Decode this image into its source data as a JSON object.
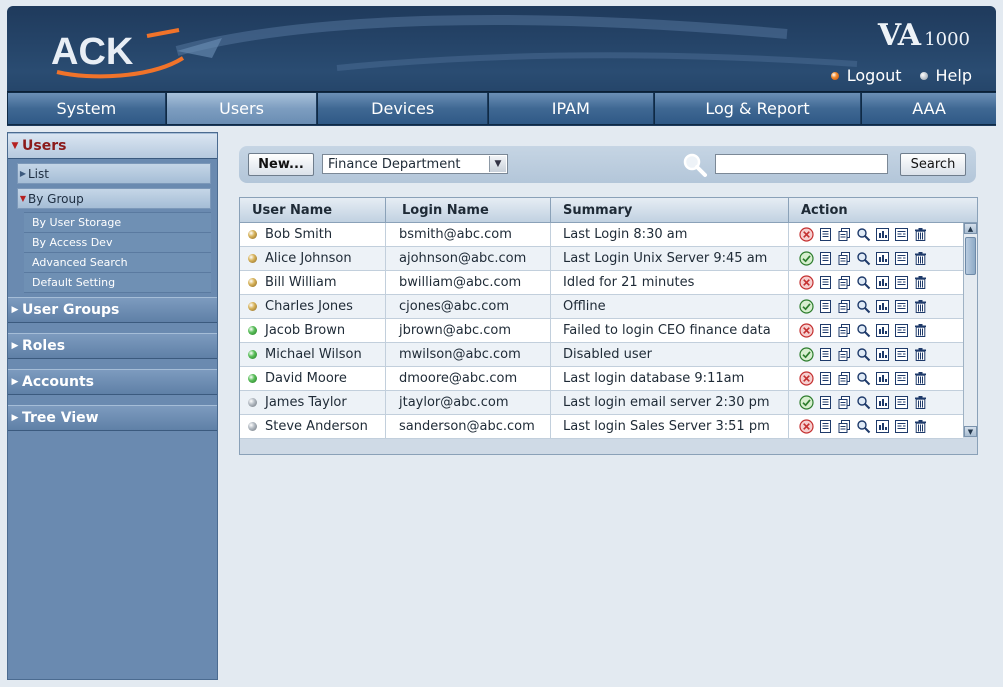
{
  "brand": {
    "logo_text": "ACK",
    "product_big": "VA",
    "product_small": "1000"
  },
  "toplinks": [
    {
      "label": "Logout"
    },
    {
      "label": "Help"
    }
  ],
  "nav": {
    "tabs": [
      {
        "label": "System"
      },
      {
        "label": "Users"
      },
      {
        "label": "Devices"
      },
      {
        "label": "IPAM"
      },
      {
        "label": "Log & Report"
      },
      {
        "label": "AAA"
      }
    ]
  },
  "sidebar": {
    "users": "Users",
    "list": "List",
    "by_group": "By Group",
    "sub": [
      "By User Storage",
      "By Access Dev",
      "Advanced Search",
      "Default Setting"
    ],
    "sections": [
      "User Groups",
      "Roles",
      "Accounts",
      "Tree View"
    ]
  },
  "toolbar": {
    "new_label": "New...",
    "group_select": "Finance Department",
    "search_value": "",
    "search_label": "Search"
  },
  "table": {
    "headers": [
      "User Name",
      "Login Name",
      "Summary",
      "Action"
    ],
    "rows": [
      {
        "name": "Bob Smith",
        "login": "bsmith@abc.com",
        "summary": "Last Login 8:30 am",
        "status": "orange",
        "state": "disabled"
      },
      {
        "name": "Alice Johnson",
        "login": "ajohnson@abc.com",
        "summary": "Last Login Unix Server 9:45 am",
        "status": "orange",
        "state": "enabled"
      },
      {
        "name": "Bill William",
        "login": "bwilliam@abc.com",
        "summary": "Idled for 21 minutes",
        "status": "orange",
        "state": "disabled"
      },
      {
        "name": "Charles Jones",
        "login": "cjones@abc.com",
        "summary": "Offline",
        "status": "orange",
        "state": "enabled"
      },
      {
        "name": "Jacob Brown",
        "login": "jbrown@abc.com",
        "summary": "Failed to login CEO finance data",
        "status": "green",
        "state": "disabled"
      },
      {
        "name": "Michael Wilson",
        "login": "mwilson@abc.com",
        "summary": "Disabled user",
        "status": "green",
        "state": "enabled"
      },
      {
        "name": "David Moore",
        "login": "dmoore@abc.com",
        "summary": "Last login database  9:11am",
        "status": "green",
        "state": "disabled"
      },
      {
        "name": "James Taylor",
        "login": "jtaylor@abc.com",
        "summary": "Last login email server 2:30 pm",
        "status": "gray",
        "state": "enabled"
      },
      {
        "name": "Steve Anderson",
        "login": "sanderson@abc.com",
        "summary": "Last login Sales Server 3:51 pm",
        "status": "gray",
        "state": "disabled"
      }
    ]
  },
  "colors": {
    "header_bg": "#1f3a5c",
    "nav_active": "#7d9dc0",
    "sidebar_bg": "#6a8ab0",
    "sidebar_active_text": "#8b1a1a",
    "logo_orange": "#f0732a"
  },
  "icons": [
    "orange-bullet-icon",
    "gray-bullet-icon",
    "search-magnifier-icon",
    "dropdown-arrow-icon",
    "enable-icon",
    "disable-icon",
    "view-icon",
    "copy-icon",
    "search-icon",
    "report-icon",
    "form-icon",
    "delete-icon"
  ]
}
